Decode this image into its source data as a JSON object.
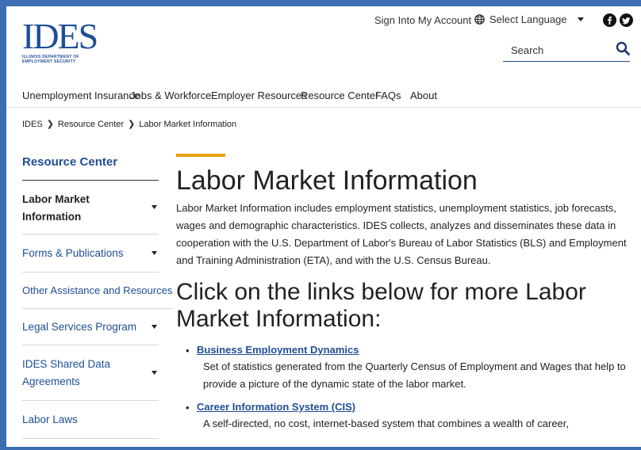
{
  "header": {
    "logo_text": "IDES",
    "logo_subtext": "ILLINOIS DEPARTMENT OF EMPLOYMENT SECURITY",
    "sign_in": "Sign Into My Account",
    "language": "Select Language",
    "search_placeholder": "Search"
  },
  "nav": {
    "items": [
      {
        "label": "Unemployment Insurance"
      },
      {
        "label": "Jobs & Workforce"
      },
      {
        "label": "Employer Resources"
      },
      {
        "label": "Resource Center"
      },
      {
        "label": "FAQs"
      },
      {
        "label": "About"
      }
    ]
  },
  "breadcrumb": [
    "IDES",
    "Resource Center",
    "Labor Market Information"
  ],
  "sidebar": {
    "title": "Resource Center",
    "items": [
      {
        "label": "Labor Market Information",
        "active": true,
        "has_caret": true
      },
      {
        "label": "Forms & Publications",
        "active": false,
        "has_caret": true
      },
      {
        "label": "Other Assistance and Resources",
        "active": false,
        "has_caret": false
      },
      {
        "label": "Legal Services Program",
        "active": false,
        "has_caret": true
      },
      {
        "label": "IDES Shared Data Agreements",
        "active": false,
        "has_caret": true
      },
      {
        "label": "Labor Laws",
        "active": false,
        "has_caret": false
      }
    ]
  },
  "content": {
    "title": "Labor Market Information",
    "intro": "Labor Market Information includes employment statistics, unemployment statistics, job forecasts, wages and demographic characteristics. IDES collects, analyzes and disseminates these data in cooperation with the U.S. Department of Labor's Bureau of Labor Statistics (BLS) and Employment and Training Administration (ETA), and with the U.S. Census Bureau.",
    "links_heading": "Click on the links below for more Labor Market Information:",
    "links": [
      {
        "title": "Business Employment Dynamics",
        "description": "Set of statistics generated from the Quarterly Census of Employment and Wages that help to provide a picture of the dynamic state of the labor market."
      },
      {
        "title": "Career Information System (CIS)",
        "description": "A self-directed, no cost, internet-based system that combines a wealth of career,"
      }
    ]
  },
  "colors": {
    "brand_blue": "#1f4e95",
    "accent_gold": "#e6a200",
    "frame_blue": "#3d6db3"
  }
}
